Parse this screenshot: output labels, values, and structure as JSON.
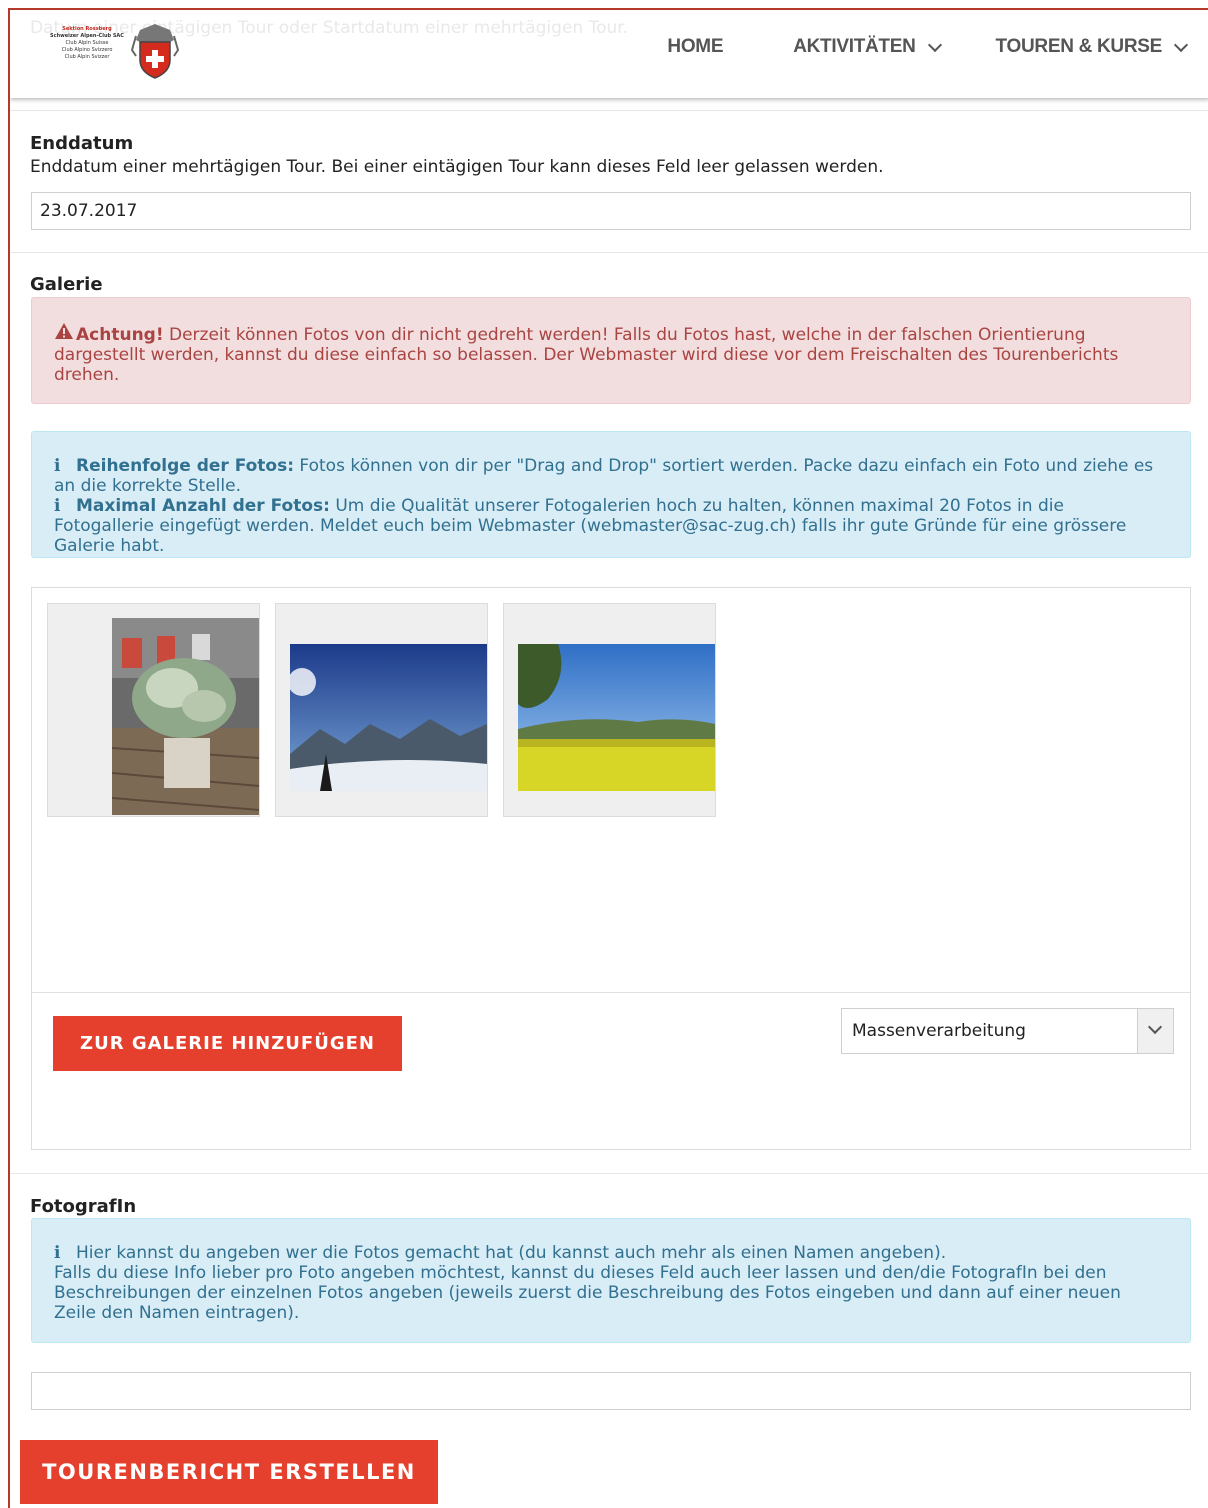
{
  "header": {
    "faded_text": "Datum einer eintägigen Tour oder Startdatum einer mehrtägigen Tour.",
    "logo": {
      "line1": "Sektion Rossberg",
      "line2": "Schweizer Alpen-Club SAC",
      "line3": "Club Alpin Suisse",
      "line4": "Club Alpino Svizzero",
      "line5": "Club Alpin Svizzer"
    },
    "nav": {
      "home": "HOME",
      "aktivitaeten": "AKTIVITÄTEN",
      "touren": "TOUREN & KURSE"
    }
  },
  "enddatum": {
    "label": "Enddatum",
    "help": "Enddatum einer mehrtägigen Tour. Bei einer eintägigen Tour kann dieses Feld leer gelassen werden.",
    "value": "23.07.2017"
  },
  "galerie": {
    "label": "Galerie",
    "warning": {
      "strong": "Achtung!",
      "text": " Derzeit können Fotos von dir nicht gedreht werden! Falls du Fotos hast, welche in der falschen Orientierung dargestellt werden, kannst du diese einfach so belassen. Der Webmaster wird diese vor dem Freischalten des Tourenberichts drehen."
    },
    "info": {
      "order_strong": "Reihenfolge der Fotos:",
      "order_text": " Fotos können von dir per \"Drag and Drop\" sortiert werden. Packe dazu einfach ein Foto und ziehe es an die korrekte Stelle.",
      "max_strong": "Maximal Anzahl der Fotos:",
      "max_text": " Um die Qualität unserer Fotogalerien hoch zu halten, können maximal 20 Fotos in die Fotogallerie eingefügt werden. Meldet euch beim Webmaster (webmaster@sac-zug.ch) falls ihr gute Gründe für eine grössere Galerie habt."
    },
    "add_button": "ZUR GALERIE HINZUFÜGEN",
    "bulk_select": "Massenverarbeitung"
  },
  "fotograf": {
    "label": "FotografIn",
    "info_line1": "Hier kannst du angeben wer die Fotos gemacht hat (du kannst auch mehr als einen Namen angeben).",
    "info_line2": "Falls du diese Info lieber pro Foto angeben möchtest, kannst du dieses Feld auch leer lassen und den/die FotografIn bei den Beschreibungen der einzelnen Fotos angeben (jeweils zuerst die Beschreibung des Fotos eingeben und dann auf einer neuen Zeile den Namen eintragen).",
    "value": ""
  },
  "submit_button": "TOURENBERICHT ERSTELLEN",
  "colors": {
    "accent": "#e5402d",
    "danger_bg": "#f2dede",
    "danger_text": "#a94442",
    "info_bg": "#d9edf7",
    "info_text": "#31708f"
  }
}
